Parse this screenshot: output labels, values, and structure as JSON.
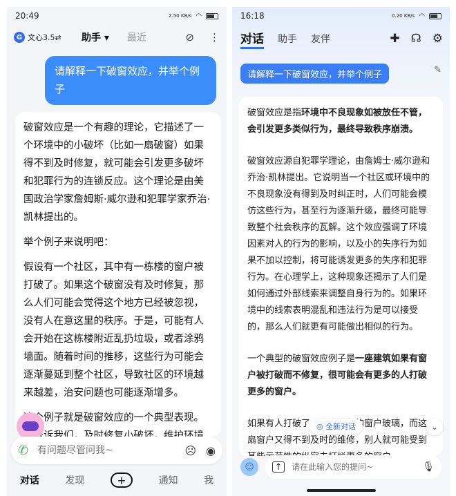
{
  "left": {
    "status": {
      "time": "20:49",
      "speed": "2.50 KB/s",
      "battery": "batt"
    },
    "brand": "文心3.5⇄",
    "tabs": [
      {
        "label": "助手 ▾"
      },
      {
        "label": "最近"
      }
    ],
    "user_message": "请解释一下破窗效应，并举个例子",
    "ai_paragraphs": [
      "破窗效应是一个有趣的理论，它描述了一个环境中的小破坏（比如一扇破窗）如果得不到及时修复，就可能会引发更多破坏和犯罪行为的连锁反应。这个理论是由美国政治学家詹姆斯·威尔逊和犯罪学家乔治·凯林提出的。",
      "举个例子来说明吧：",
      "假设有一个社区，其中有一栋楼的窗户被打破了。如果这个破窗没有及时修复，那么人们可能会觉得这个地方已经被忽视，没有人在意这里的秩序。于是，可能有人会开始在这栋楼附近乱扔垃圾，或者涂鸦墙面。随着时间的推移，这些行为可能会逐渐蔓延到整个社区，导致社区的环境越来越差，治安问题也可能逐渐增多。",
      "这个例子就是破窗效应的一个典型表现。它告诉我们，及时修复小破坏，维护环境的整洁和秩序，对于防止更大问题"
    ],
    "input_placeholder": "有问题尽管问我~",
    "nav": [
      "对话",
      "发现",
      "+",
      "通知",
      "我"
    ]
  },
  "right": {
    "status": {
      "time": "16:18",
      "speed": "0.20 KB/s"
    },
    "tabs": [
      "对话",
      "助手",
      "友伴"
    ],
    "user_message": "请解释一下破窗效应，并举个例子",
    "p1_normal": "破窗效应是指",
    "p1_bold": "环境中不良现象如被放任不管，会引发更多类似行为，最终导致秩序崩溃。",
    "p2": "破窗效应源自犯罪学理论，由詹姆士·威尔逊和乔治·凯林提出。它说明当一个社区或环境中的不良现象没有得到及时纠正时，人们可能会模仿这些行为，甚至行为逐渐升级，最终可能导致整个社会秩序的瓦解。这个效应强调了环境因素对人的行为的影响，以及小的失序行为如果不加以控制，将可能诱发更多的失序和犯罪行为。在心理学上，这种现象还揭示了人们是如何通过外部线索来调整自身行为的。如果环境中的线索表明混乱和违法行为是可以接受的，那么人们就更有可能做出相似的行为。",
    "p3_normal": "一个典型的破窗效应例子是",
    "p3_bold": "一座建筑如果有窗户被打破而不修复，很可能会有更多的人打破更多的窗户。",
    "p4": "如果有人打破了一幢建筑物的窗户玻璃，而这扇窗户又得不到及时的维修，别人就可能受到某些示范性的纵容去打烂更多的窗户。",
    "new_chat": "全新对话",
    "input_placeholder": "请在此输入您的提问~"
  }
}
